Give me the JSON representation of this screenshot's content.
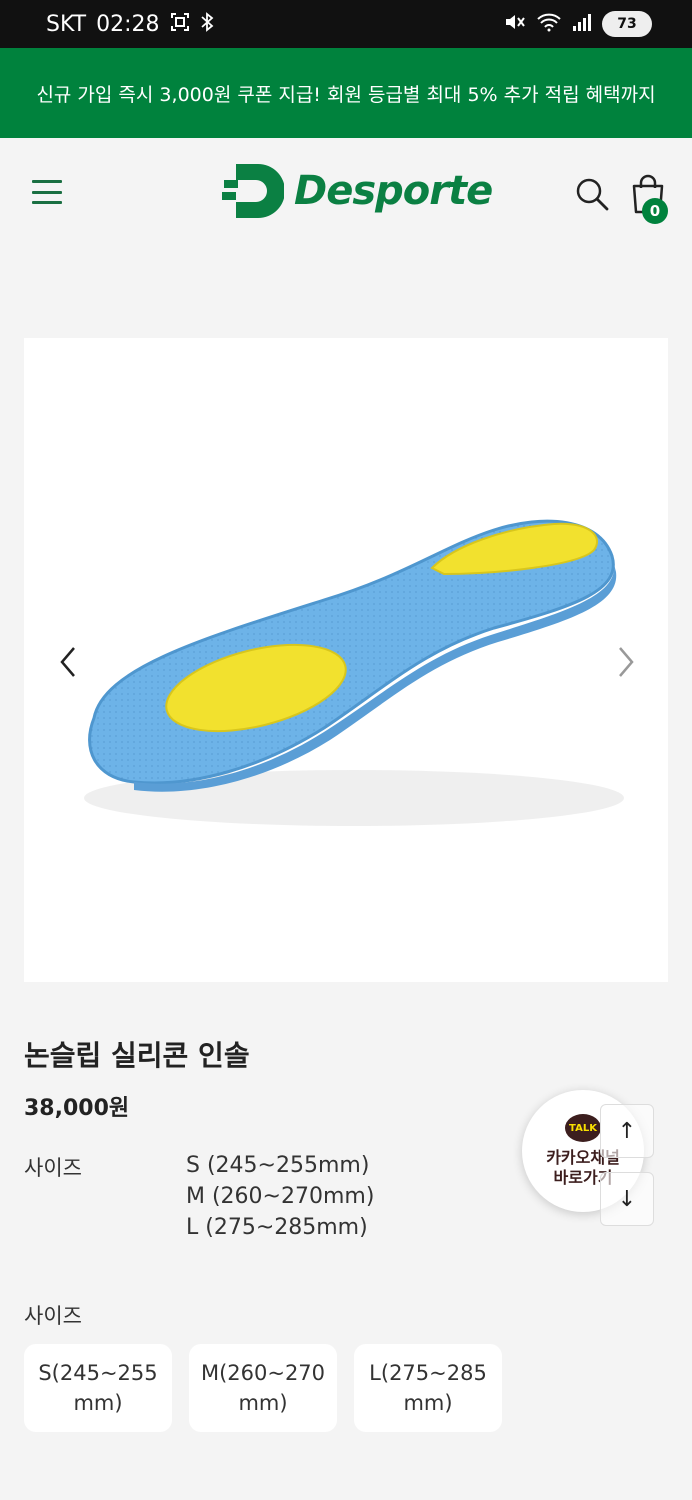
{
  "status_bar": {
    "carrier": "SKT",
    "time": "02:28",
    "battery": "73"
  },
  "promo": {
    "text": "신규 가입 즉시 3,000원 쿠폰 지급! 회원 등급별 최대 5% 추가 적립 혜택까지"
  },
  "header": {
    "logo_text": "Desporte",
    "cart_count": "0",
    "icons": {
      "menu": "hamburger-menu-icon",
      "search": "search-icon",
      "cart": "shopping-bag-icon"
    }
  },
  "colors": {
    "brand_green": "#00823d",
    "insole_blue": "#6db3e8",
    "insole_yellow": "#f2e12e"
  },
  "product": {
    "title": "논슬립 실리콘 인솔",
    "price": "38,000원",
    "spec_label": "사이즈",
    "spec_values": [
      "S (245~255mm)",
      "M (260~270mm)",
      "L (275~285mm)"
    ]
  },
  "options": {
    "label": "사이즈",
    "items": [
      "S(245~255 mm)",
      "M(260~270 mm)",
      "L(275~285 mm)"
    ]
  },
  "floating": {
    "kakao_badge": "TALK",
    "kakao_text": "카카오채널\n바로가기",
    "scroll_up": "↑",
    "scroll_down": "↓"
  }
}
